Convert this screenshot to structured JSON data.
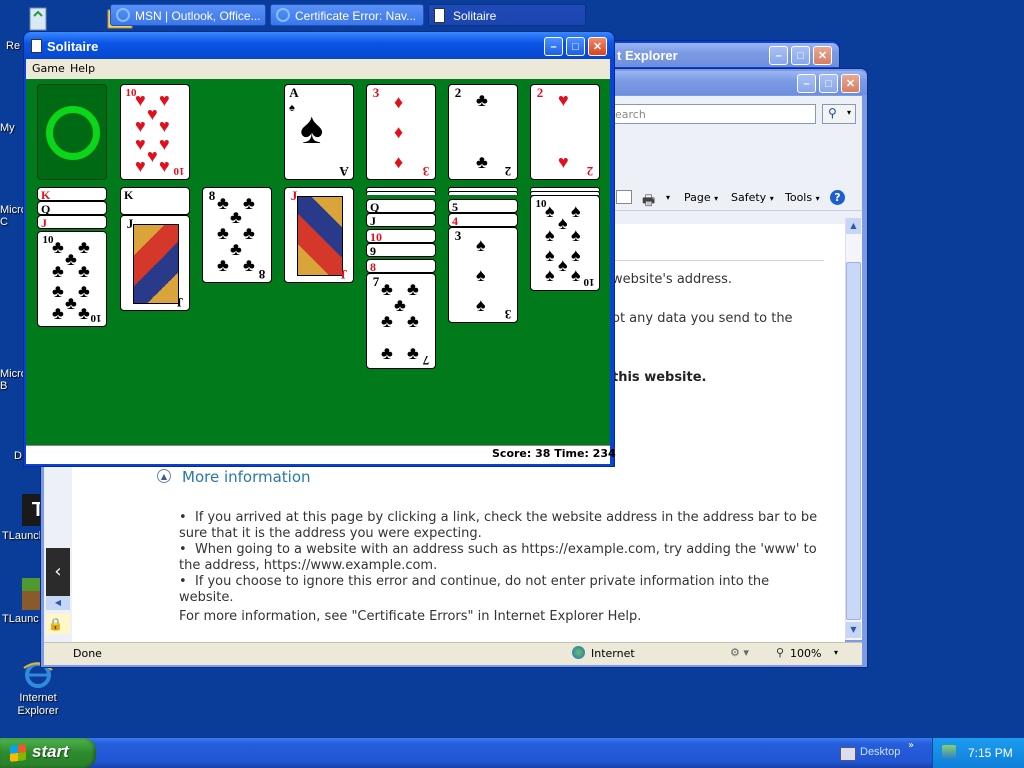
{
  "desktop": {
    "icons": [
      {
        "label": "Re",
        "name": "recycle-bin"
      },
      {
        "label": "My",
        "name": "my-documents"
      },
      {
        "label": "Micro C",
        "name": "microsoft-c"
      },
      {
        "label": "Micro B",
        "name": "microsoft-b"
      },
      {
        "label": "D",
        "name": "d-icon"
      },
      {
        "label": "TLaunch",
        "name": "tlauncher"
      },
      {
        "label": "TLaunc",
        "name": "tlauncher-shortcut"
      },
      {
        "label": "Internet Explorer",
        "name": "internet-explorer"
      }
    ]
  },
  "ie_back": {
    "title": "t Explorer"
  },
  "ie_front": {
    "search_placeholder": "earch",
    "toolbar": {
      "page": "Page",
      "safety": "Safety",
      "tools": "Tools"
    },
    "partial_lines": [
      "website's address.",
      "ot any data you send to the",
      "this website."
    ],
    "more_info_title": "More information",
    "bullets": [
      "If you arrived at this page by clicking a link, check the website address in the address bar to be sure that it is the address you were expecting.",
      "When going to a website with an address such as https://example.com, try adding the 'www' to the address, https://www.example.com.",
      "If you choose to ignore this error and continue, do not enter private information into the website."
    ],
    "footer_text": "For more information, see \"Certificate Errors\" in Internet Explorer Help.",
    "status": {
      "done": "Done",
      "zone": "Internet",
      "zoom": "100%"
    }
  },
  "solitaire": {
    "title": "Solitaire",
    "menu": [
      "Game",
      "Help"
    ],
    "status": "Score: 38 Time: 234",
    "waste": {
      "rank": "10",
      "suit": "♥",
      "color": "red"
    },
    "foundations": [
      {
        "rank": "A",
        "suit": "♠",
        "color": "blk"
      },
      {
        "rank": "3",
        "suit": "♦",
        "color": "red"
      },
      {
        "rank": "2",
        "suit": "♣",
        "color": "blk"
      },
      {
        "rank": "2",
        "suit": "♥",
        "color": "red"
      }
    ],
    "tableau": [
      {
        "fanned": [
          {
            "rank": "K",
            "color": "red"
          },
          {
            "rank": "Q",
            "color": "blk"
          },
          {
            "rank": "J",
            "color": "red"
          }
        ],
        "top": {
          "rank": "10",
          "suit": "♣",
          "color": "blk"
        }
      },
      {
        "fanned": [
          {
            "rank": "K",
            "color": "blk"
          }
        ],
        "top": {
          "rank": "J",
          "suit": "♠",
          "color": "blk"
        }
      },
      {
        "fanned": [],
        "top": {
          "rank": "8",
          "suit": "♣",
          "color": "blk"
        }
      },
      {
        "fanned": [],
        "top": {
          "rank": "J",
          "suit": "♥",
          "color": "red"
        }
      },
      {
        "fanned": [
          {
            "rank": "Q",
            "color": "blk"
          },
          {
            "rank": "J",
            "color": "blk"
          },
          {
            "rank": "10",
            "color": "red"
          },
          {
            "rank": "9",
            "color": "blk"
          },
          {
            "rank": "8",
            "color": "red"
          }
        ],
        "top": {
          "rank": "7",
          "suit": "♣",
          "color": "blk"
        }
      },
      {
        "fanned": [
          {
            "rank": "5",
            "color": "blk"
          },
          {
            "rank": "4",
            "color": "red"
          }
        ],
        "top": {
          "rank": "3",
          "suit": "♠",
          "color": "blk"
        }
      },
      {
        "fanned": [],
        "top": {
          "rank": "10",
          "suit": "♠",
          "color": "blk"
        }
      }
    ]
  },
  "taskbar": {
    "start": "start",
    "items": [
      {
        "label": "MSN | Outlook, Office..."
      },
      {
        "label": "Certificate Error: Nav..."
      },
      {
        "label": "Solitaire"
      }
    ],
    "desktop_label": "Desktop",
    "clock": "7:15 PM"
  }
}
